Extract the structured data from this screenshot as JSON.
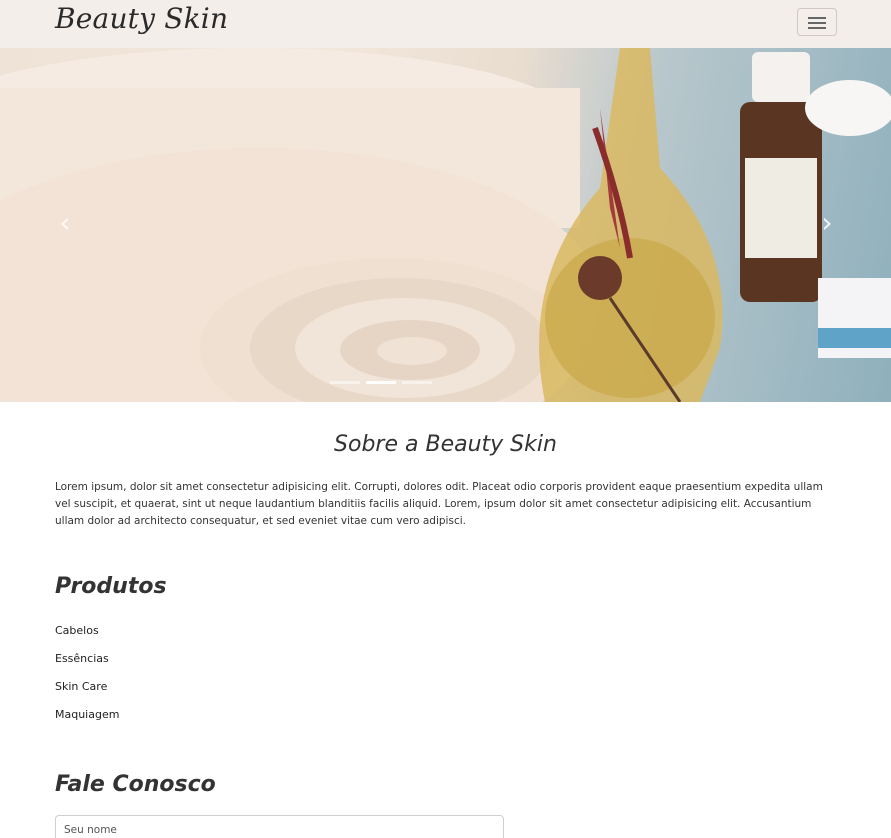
{
  "navbar": {
    "brand": "Beauty Skin",
    "toggler_icon": "menu-icon"
  },
  "carousel": {
    "prev_icon": "chevron-left-icon",
    "next_icon": "chevron-right-icon",
    "prev_glyph": "‹",
    "next_glyph": "›",
    "indicator_count": 3,
    "active_indicator": 1
  },
  "about": {
    "title": "Sobre a Beauty Skin",
    "text": "Lorem ipsum, dolor sit amet consectetur adipisicing elit. Corrupti, dolores odit. Placeat odio corporis provident eaque praesentium expedita ullam vel suscipit, et quaerat, sint ut neque laudantium blanditiis facilis aliquid. Lorem, ipsum dolor sit amet consectetur adipisicing elit. Accusantium ullam dolor ad architecto consequatur, et sed eveniet vitae cum vero adipisci."
  },
  "products": {
    "title": "Produtos",
    "items": [
      "Cabelos",
      "Essências",
      "Skin Care",
      "Maquiagem"
    ]
  },
  "contact": {
    "title": "Fale Conosco",
    "name_placeholder": "Seu nome"
  },
  "colors": {
    "navbar_bg": "#f4eeea",
    "text": "#333333"
  }
}
